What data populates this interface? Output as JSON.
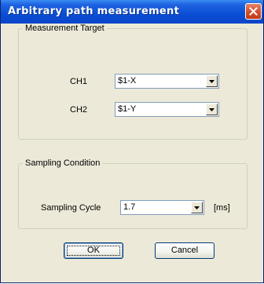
{
  "window": {
    "title": "Arbitrary path measurement",
    "close_icon": "close-icon"
  },
  "measurement_target": {
    "legend": "Measurement Target",
    "ch1": {
      "label": "CH1",
      "value": "$1-X"
    },
    "ch2": {
      "label": "CH2",
      "value": "$1-Y"
    }
  },
  "sampling_condition": {
    "legend": "Sampling Condition",
    "cycle_label": "Sampling Cycle",
    "cycle_value": "1.7",
    "unit": "[ms]"
  },
  "buttons": {
    "ok_label": "OK",
    "cancel_label": "Cancel"
  },
  "colors": {
    "titlebar": "#0a4ed6",
    "dialog_bg": "#ece9d8",
    "close_button": "#d4512f"
  }
}
